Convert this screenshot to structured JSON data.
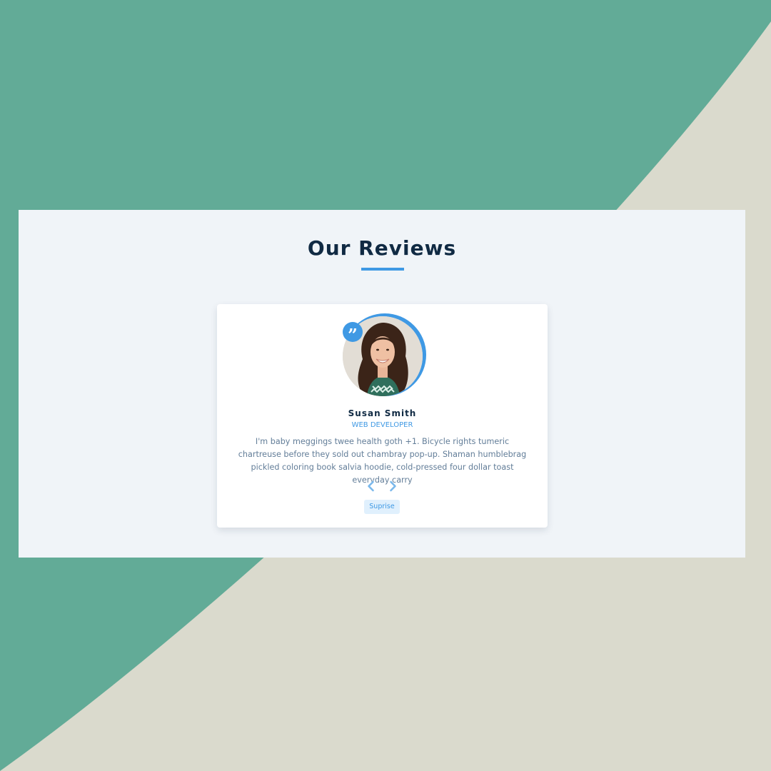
{
  "section": {
    "title": "Our Reviews"
  },
  "review": {
    "name": "Susan Smith",
    "job": "WEB DEVELOPER",
    "text": "I'm baby meggings twee health goth +1. Bicycle rights tumeric chartreuse before they sold out chambray pop-up. Shaman humblebrag pickled coloring book salvia hoodie, cold-pressed four dollar toast everyday carry",
    "quote_icon": "quote-icon",
    "quote_glyph": "”"
  },
  "controls": {
    "prev_icon": "chevron-left-icon",
    "next_icon": "chevron-right-icon",
    "suprise_label": "Suprise"
  },
  "colors": {
    "accent": "#3f99e4",
    "heading": "#102a43",
    "body_text": "#627d98",
    "panel_bg": "#f0f4f8",
    "backdrop_green": "#62ab97",
    "backdrop_beige": "#dadacd"
  }
}
